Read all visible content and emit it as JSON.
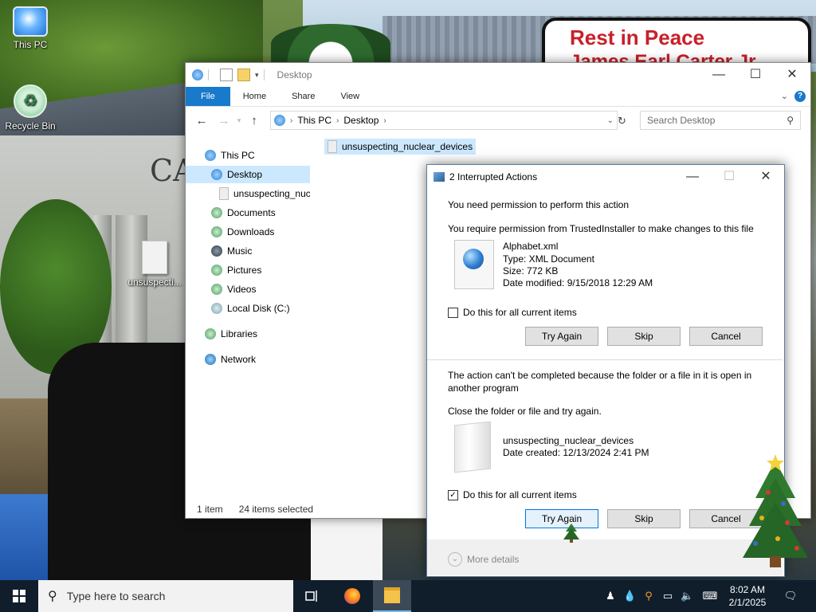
{
  "desktop": {
    "icons": [
      {
        "label": "This PC"
      },
      {
        "label": "Recycle Bin"
      },
      {
        "label": "unsuspecti..."
      }
    ],
    "wallpaper": {
      "sign_title": "Rest in Peace",
      "sign_subtitle": "James Earl Carter Jr.",
      "building_text": "CA"
    }
  },
  "explorer": {
    "title": "Desktop",
    "tabs": [
      "File",
      "Home",
      "Share",
      "View"
    ],
    "address": [
      "This PC",
      "Desktop"
    ],
    "search_placeholder": "Search Desktop",
    "nav": [
      {
        "label": "This PC"
      },
      {
        "label": "Desktop"
      },
      {
        "label": "unsuspecting_nuc"
      },
      {
        "label": "Documents"
      },
      {
        "label": "Downloads"
      },
      {
        "label": "Music"
      },
      {
        "label": "Pictures"
      },
      {
        "label": "Videos"
      },
      {
        "label": "Local Disk (C:)"
      },
      {
        "label": "Libraries"
      },
      {
        "label": "Network"
      }
    ],
    "content_item": "unsuspecting_nuclear_devices",
    "status": {
      "items": "1 item",
      "selected": "24 items selected"
    }
  },
  "dialog": {
    "title": "2 Interrupted Actions",
    "section1": {
      "heading": "You need permission to perform this action",
      "message": "You require permission from TrustedInstaller to make changes to this file",
      "file": {
        "name": "Alphabet.xml",
        "type": "Type: XML Document",
        "size": "Size: 772 KB",
        "modified": "Date modified: 9/15/2018 12:29 AM"
      },
      "checkbox_label": "Do this for all current items",
      "checked": false,
      "buttons": {
        "try_again": "Try Again",
        "skip": "Skip",
        "cancel": "Cancel"
      }
    },
    "section2": {
      "heading": "The action can't be completed because the folder or a file in it is open in another program",
      "message": "Close the folder or file and try again.",
      "file": {
        "name": "unsuspecting_nuclear_devices",
        "created": "Date created: 12/13/2024 2:41 PM"
      },
      "checkbox_label": "Do this for all current items",
      "checked": true,
      "buttons": {
        "try_again": "Try Again",
        "skip": "Skip",
        "cancel": "Cancel"
      }
    },
    "more_details": "More details"
  },
  "taskbar": {
    "search_placeholder": "Type here to search",
    "time": "8:02 AM",
    "date": "2/1/2025"
  },
  "colors": {
    "accent": "#1979ca",
    "selection": "#cce8ff",
    "taskbar": "#101e2c"
  }
}
